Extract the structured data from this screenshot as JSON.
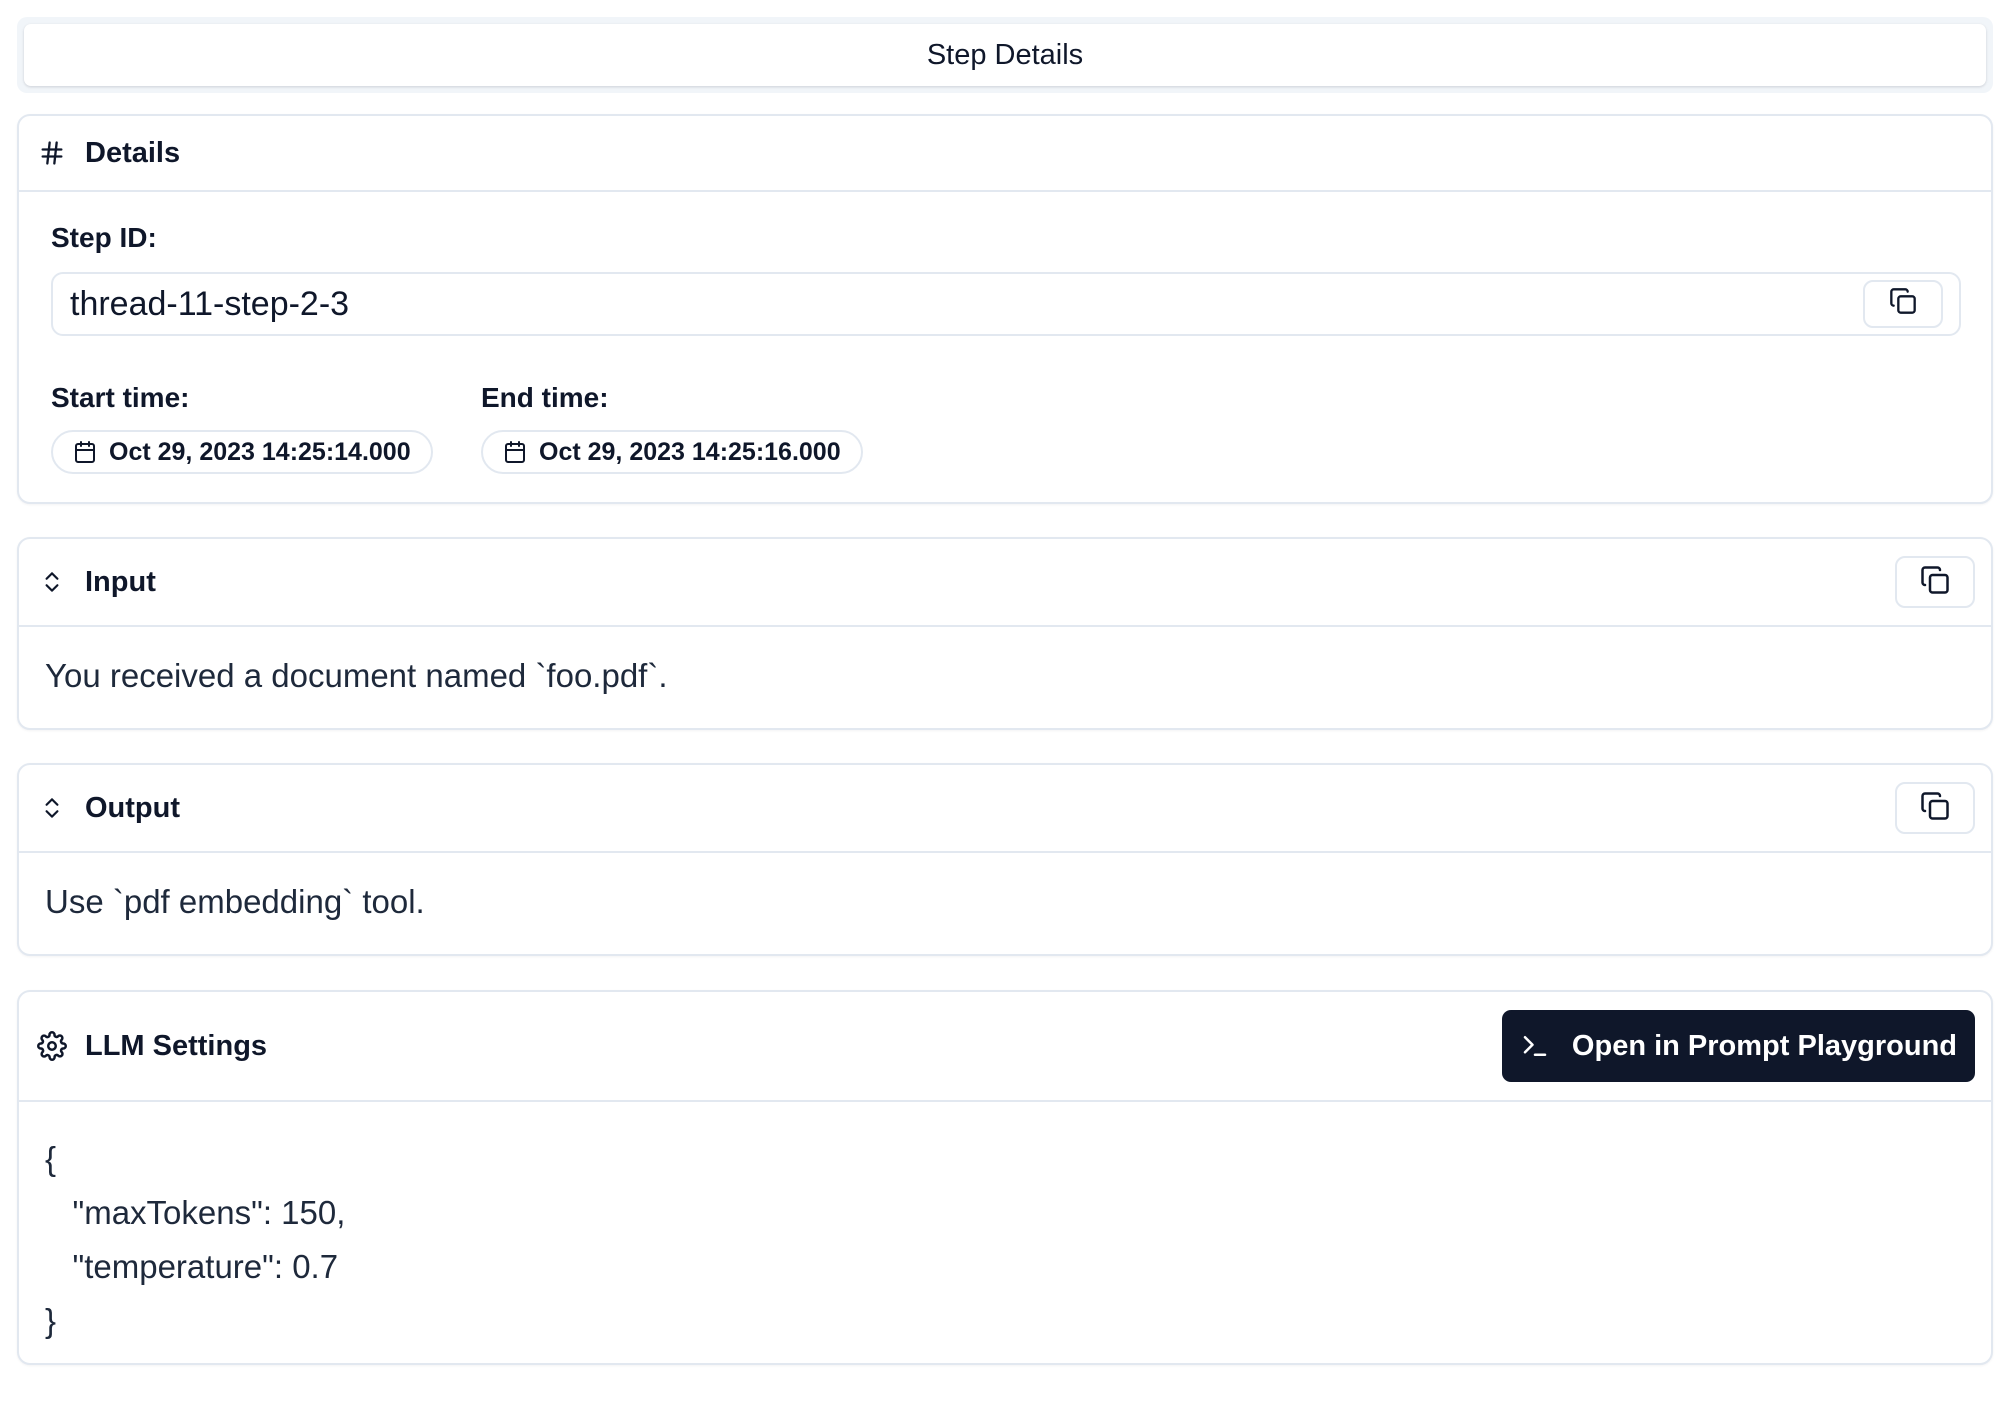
{
  "tab": {
    "label": "Step Details"
  },
  "details": {
    "title": "Details",
    "step_id_label": "Step ID:",
    "step_id_value": "thread-11-step-2-3",
    "start_label": "Start time:",
    "start_value": "Oct 29, 2023 14:25:14.000",
    "end_label": "End time:",
    "end_value": "Oct 29, 2023 14:25:16.000"
  },
  "input": {
    "title": "Input",
    "text": "You received a document named `foo.pdf`."
  },
  "output": {
    "title": "Output",
    "text": "Use `pdf embedding` tool."
  },
  "llm": {
    "title": "LLM Settings",
    "button_label": "Open in Prompt Playground",
    "code_lines": [
      "{",
      "   \"maxTokens\": 150,",
      "   \"temperature\": 0.7",
      "}"
    ]
  },
  "icons": {
    "details": "hash-icon",
    "collapse": "chevrons-up-down-icon",
    "copy": "copy-icon",
    "calendar": "calendar-icon",
    "settings": "gear-icon",
    "terminal": "terminal-icon"
  },
  "colors": {
    "primary": "#0f172a",
    "border": "#e2e8f0",
    "tab_bg": "#f1f5f9"
  }
}
